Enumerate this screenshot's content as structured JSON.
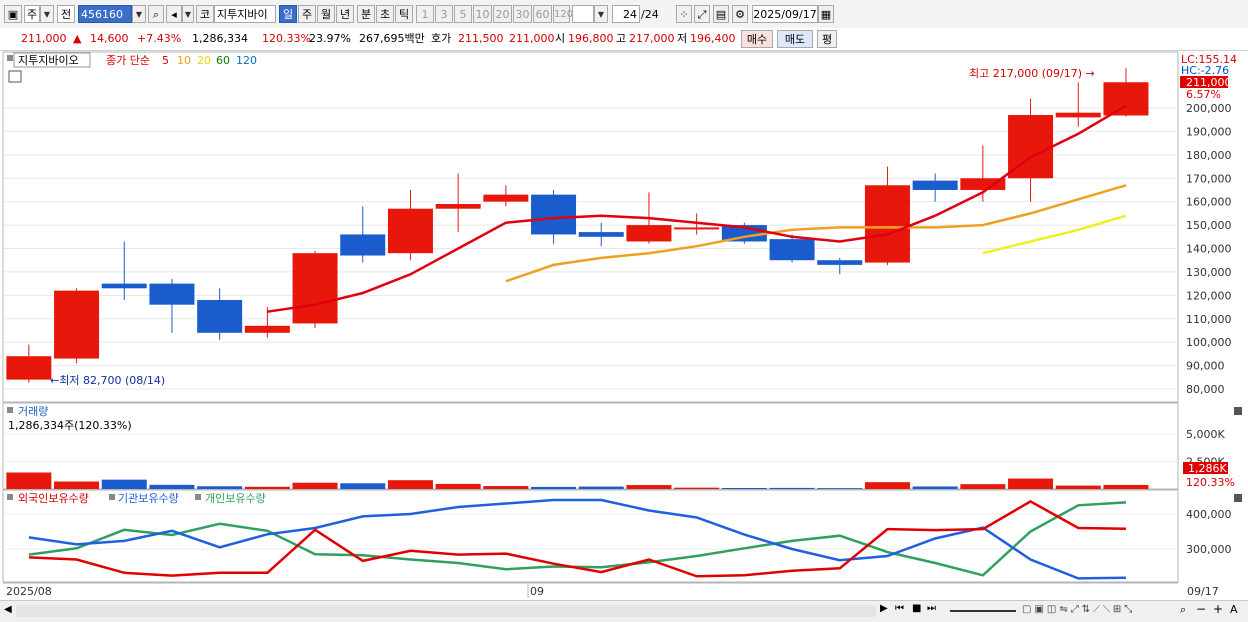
{
  "toolbar": {
    "period_week": "주",
    "prev_label": "전",
    "code": "456160",
    "code_btn": "코",
    "stock_name": "지투지바이",
    "periods": [
      "일",
      "주",
      "월",
      "년",
      "분",
      "초",
      "틱"
    ],
    "intervals": [
      "1",
      "3",
      "5",
      "10",
      "20",
      "30",
      "60",
      "120"
    ],
    "count": "24",
    "count_total": "/24",
    "date": "2025/09/17"
  },
  "quote": {
    "price": "211,000",
    "change_arrow": "▲",
    "change": "14,600",
    "change_pct": "+7.43%",
    "volume": "1,286,334",
    "volume_ratio": "120.33%",
    "turnover": "23.97%",
    "amount": "267,695백만",
    "bid_label": "호가",
    "bid": "211,500",
    "ask": "211,000",
    "open_label": "시",
    "open": "196,800",
    "high_label": "고",
    "high": "217,000",
    "low_label": "저",
    "low": "196,400",
    "buy_btn": "매수",
    "sell_btn": "매도",
    "eval_btn": "평"
  },
  "price_panel": {
    "title": "지투지바이오",
    "ma_label": "종가 단순",
    "ma_periods": [
      "5",
      "10",
      "20",
      "60",
      "120"
    ],
    "ma_colors": [
      "#e00000",
      "#f0a000",
      "#f0f000",
      "#008000",
      "#0070c0"
    ],
    "lc": "LC:155.14",
    "hc": "HC:-2.76",
    "last_price": "211,000",
    "last_pct": "6.57%",
    "high_note": "최고 217,000 (09/17) →",
    "low_note": "←최저 82,700 (08/14)",
    "y_ticks": [
      "200,000",
      "190,000",
      "180,000",
      "170,000",
      "160,000",
      "150,000",
      "140,000",
      "130,000",
      "120,000",
      "110,000",
      "100,000",
      "90,000",
      "80,000"
    ]
  },
  "volume_panel": {
    "title": "거래량",
    "value": "1,286,334주(120.33%)",
    "y_ticks": [
      "5,000K",
      "2,500K"
    ],
    "last": "1,286K",
    "last_pct": "120.33%"
  },
  "holdings_panel": {
    "series": [
      "외국인보유수량",
      "기관보유수량",
      "개인보유수량"
    ],
    "colors": [
      "#e00000",
      "#2060e0",
      "#30a060"
    ],
    "y_ticks": [
      "400,000",
      "300,000"
    ]
  },
  "x_axis": {
    "start": "2025/08",
    "mid": "09",
    "end": "09/17"
  },
  "chart_data": {
    "type": "candlestick",
    "candles": [
      {
        "o": 84000,
        "c": 94000,
        "h": 99000,
        "l": 82700
      },
      {
        "o": 93000,
        "c": 122000,
        "h": 123000,
        "l": 91000
      },
      {
        "o": 125000,
        "c": 123000,
        "h": 143000,
        "l": 118000
      },
      {
        "o": 125000,
        "c": 116000,
        "h": 127000,
        "l": 104000
      },
      {
        "o": 118000,
        "c": 104000,
        "h": 123000,
        "l": 101000
      },
      {
        "o": 104000,
        "c": 107000,
        "h": 115000,
        "l": 102000
      },
      {
        "o": 108000,
        "c": 138000,
        "h": 139000,
        "l": 106000
      },
      {
        "o": 146000,
        "c": 137000,
        "h": 158000,
        "l": 134000
      },
      {
        "o": 138000,
        "c": 157000,
        "h": 165000,
        "l": 135000
      },
      {
        "o": 157000,
        "c": 159000,
        "h": 172000,
        "l": 147000
      },
      {
        "o": 160000,
        "c": 163000,
        "h": 167000,
        "l": 158000
      },
      {
        "o": 163000,
        "c": 146000,
        "h": 165000,
        "l": 142000
      },
      {
        "o": 147000,
        "c": 145000,
        "h": 151000,
        "l": 141000
      },
      {
        "o": 143000,
        "c": 150000,
        "h": 164000,
        "l": 142000
      },
      {
        "o": 149000,
        "c": 149000,
        "h": 155000,
        "l": 146000
      },
      {
        "o": 150000,
        "c": 143000,
        "h": 151000,
        "l": 142000
      },
      {
        "o": 144000,
        "c": 135000,
        "h": 146000,
        "l": 134000
      },
      {
        "o": 135000,
        "c": 133000,
        "h": 136000,
        "l": 129000
      },
      {
        "o": 134000,
        "c": 167000,
        "h": 175000,
        "l": 133000
      },
      {
        "o": 169000,
        "c": 165000,
        "h": 172000,
        "l": 160000
      },
      {
        "o": 165000,
        "c": 170000,
        "h": 184000,
        "l": 160000
      },
      {
        "o": 170000,
        "c": 197000,
        "h": 204000,
        "l": 160000
      },
      {
        "o": 196000,
        "c": 198000,
        "h": 211000,
        "l": 192000
      },
      {
        "o": 196800,
        "c": 211000,
        "h": 217000,
        "l": 196400
      }
    ],
    "ma5": [
      null,
      null,
      null,
      null,
      null,
      113000,
      116000,
      121000,
      129000,
      140000,
      151000,
      153000,
      154000,
      153000,
      151000,
      149000,
      145000,
      143000,
      146000,
      154000,
      164000,
      179000,
      189000,
      201000
    ],
    "ma10": [
      null,
      null,
      null,
      null,
      null,
      null,
      null,
      null,
      null,
      null,
      126000,
      133000,
      136000,
      138000,
      141000,
      145000,
      148000,
      149000,
      149000,
      149000,
      150000,
      155000,
      161000,
      167000
    ],
    "ma20": [
      null,
      null,
      null,
      null,
      null,
      null,
      null,
      null,
      null,
      null,
      null,
      null,
      null,
      null,
      null,
      null,
      null,
      null,
      null,
      null,
      138000,
      143000,
      148000,
      154000
    ],
    "volume": [
      1500,
      680,
      850,
      380,
      250,
      200,
      570,
      520,
      800,
      460,
      270,
      190,
      220,
      360,
      120,
      90,
      100,
      80,
      620,
      230,
      440,
      950,
      310,
      370
    ],
    "holdings": {
      "foreign": [
        276000,
        270000,
        232000,
        224000,
        232000,
        232000,
        355000,
        266000,
        295000,
        284000,
        287000,
        258000,
        234000,
        270000,
        222000,
        225000,
        238000,
        245000,
        357000,
        354000,
        357000,
        436000,
        360000,
        358000
      ],
      "institution": [
        333000,
        313000,
        323000,
        352000,
        305000,
        342000,
        360000,
        393000,
        400000,
        420000,
        430000,
        440000,
        440000,
        410000,
        390000,
        341000,
        300000,
        268000,
        280000,
        330000,
        361000,
        270000,
        216000,
        218000
      ],
      "individual": [
        284000,
        302000,
        355000,
        340000,
        372000,
        352000,
        285000,
        282000,
        270000,
        260000,
        242000,
        250000,
        248000,
        262000,
        280000,
        302000,
        323000,
        338000,
        291000,
        260000,
        225000,
        350000,
        425000,
        433000
      ]
    }
  }
}
